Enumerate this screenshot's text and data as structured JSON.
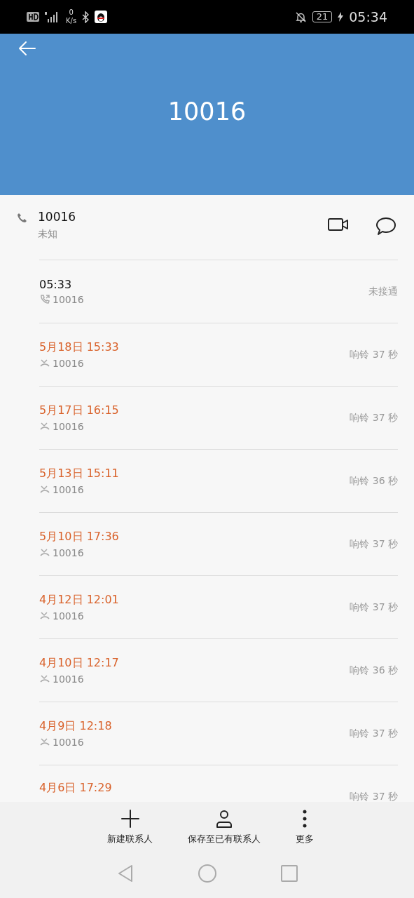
{
  "status_bar": {
    "network_speed": [
      "0",
      "K/s"
    ],
    "battery": "21",
    "time": "05:34"
  },
  "header": {
    "title": "10016"
  },
  "contact": {
    "number": "10016",
    "label": "未知"
  },
  "calls": [
    {
      "missed": false,
      "time": "05:33",
      "number": "10016",
      "result": "未接通"
    },
    {
      "missed": true,
      "time": "5月18日 15:33",
      "number": "10016",
      "result": "响铃 37 秒"
    },
    {
      "missed": true,
      "time": "5月17日 16:15",
      "number": "10016",
      "result": "响铃 37 秒"
    },
    {
      "missed": true,
      "time": "5月13日 15:11",
      "number": "10016",
      "result": "响铃 36 秒"
    },
    {
      "missed": true,
      "time": "5月10日 17:36",
      "number": "10016",
      "result": "响铃 37 秒"
    },
    {
      "missed": true,
      "time": "4月12日 12:01",
      "number": "10016",
      "result": "响铃 37 秒"
    },
    {
      "missed": true,
      "time": "4月10日 12:17",
      "number": "10016",
      "result": "响铃 36 秒"
    },
    {
      "missed": true,
      "time": "4月9日 12:18",
      "number": "10016",
      "result": "响铃 37 秒"
    },
    {
      "missed": true,
      "time": "4月6日 17:29",
      "result": "响铃 37 秒"
    }
  ],
  "toolbar": [
    {
      "kind": "add",
      "label": "新建联系人"
    },
    {
      "kind": "person",
      "label": "保存至已有联系人"
    },
    {
      "kind": "more",
      "label": "更多"
    }
  ]
}
